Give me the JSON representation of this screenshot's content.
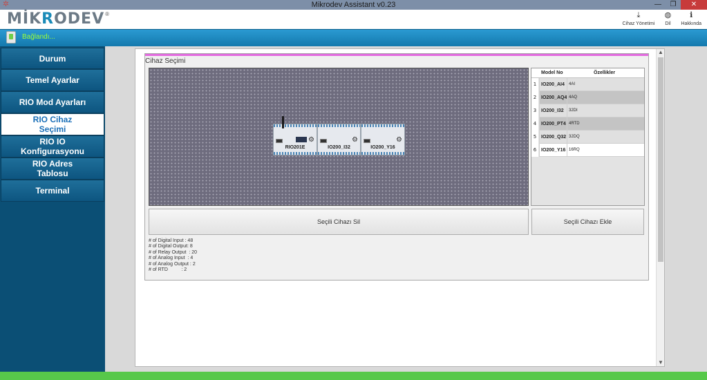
{
  "window": {
    "title": "Mikrodev Assistant v0.23",
    "minimize_glyph": "—",
    "restore_glyph": "❐",
    "close_glyph": "✕",
    "app_icon": "gear-icon"
  },
  "header": {
    "logo_prefix": "MİK",
    "logo_accent": "R",
    "logo_suffix": "ODEV",
    "logo_reg": "®",
    "actions": [
      {
        "label": "Cihaz Yönetimi",
        "icon": "download-icon",
        "glyph": "⤓"
      },
      {
        "label": "Dil",
        "icon": "globe-icon",
        "glyph": "◍"
      },
      {
        "label": "Hakkında",
        "icon": "info-icon",
        "glyph": "ℹ"
      }
    ]
  },
  "connection": {
    "status_text": "Bağlandı...",
    "icon": "usb-device-icon",
    "color": "#9bff3a"
  },
  "sidebar": {
    "items": [
      {
        "label": "Durum",
        "active": false
      },
      {
        "label": "Temel Ayarlar",
        "active": false
      },
      {
        "label": "RIO Mod Ayarları",
        "active": false
      },
      {
        "label": "RIO Cihaz\nSeçimi",
        "active": true
      },
      {
        "label": "RIO IO\nKonfigurasyonu",
        "active": false
      },
      {
        "label": "RIO Adres\nTablosu",
        "active": false
      },
      {
        "label": "Terminal",
        "active": false
      }
    ]
  },
  "device_selection": {
    "group_title": "Cihaz Seçimi",
    "devices": [
      {
        "label": "RIO201E"
      },
      {
        "label": "IO200_I32"
      },
      {
        "label": "IO200_Y16"
      }
    ],
    "table": {
      "headers": [
        "Model No",
        "Özellikler"
      ],
      "rows": [
        {
          "num": "1",
          "model": "IO200_AI4",
          "feature": "4AI"
        },
        {
          "num": "2",
          "model": "IO200_AQ4",
          "feature": "4AQ"
        },
        {
          "num": "3",
          "model": "IO200_I32",
          "feature": "32DI"
        },
        {
          "num": "4",
          "model": "IO200_PT4",
          "feature": "4RTD"
        },
        {
          "num": "5",
          "model": "IO200_Q32",
          "feature": "32DQ"
        },
        {
          "num": "6",
          "model": "IO200_Y16",
          "feature": "16RQ"
        }
      ]
    },
    "delete_button": "Seçili Cihazı Sil",
    "add_button": "Seçili Cihazı Ekle",
    "stats": [
      "# of Digital Input : 48",
      "# of Digital Output: 8",
      "# of Relay Output  : 20",
      "# of Analog Input  : 4",
      "# of Analog Output : 2",
      "# of RTD          : 2"
    ]
  },
  "colors": {
    "accent_blue": "#1a8bb8",
    "sidebar_bg": "#0b4f75",
    "highlight_pink": "#e26adf",
    "status_green": "#57c84a"
  }
}
